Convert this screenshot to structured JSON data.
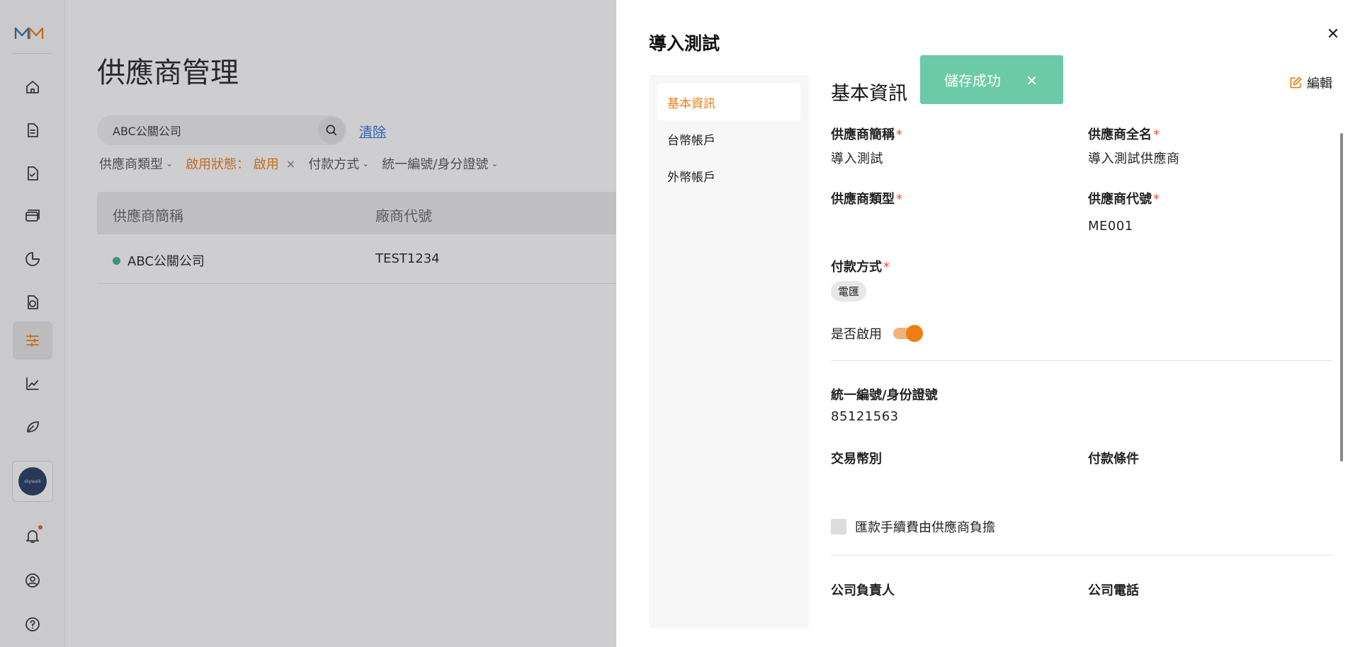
{
  "nav": {
    "logo_alt": "MM",
    "org_label": "skywalk",
    "items": [
      "home",
      "document",
      "invoice-check",
      "card",
      "pie-chart",
      "coin-document",
      "sliders",
      "line-chart",
      "leaf"
    ],
    "bottom": [
      "bell",
      "user-circle",
      "help-circle"
    ]
  },
  "page": {
    "title": "供應商管理",
    "search_value": "ABC公關公司",
    "clear_label": "清除",
    "filters": {
      "type": "供應商類型",
      "status": "啟用狀態： 啟用",
      "payment": "付款方式",
      "tax_id": "統一編號/身分證號"
    },
    "table": {
      "headers": [
        "供應商簡稱",
        "廠商代號"
      ],
      "rows": [
        {
          "name": "ABC公關公司",
          "code": "TEST1234"
        }
      ]
    }
  },
  "drawer": {
    "title": "導入測試",
    "tabs": [
      "基本資訊",
      "台幣帳戶",
      "外幣帳戶"
    ],
    "section_title": "基本資訊",
    "edit_label": "編輯",
    "fields": {
      "short_name_label": "供應商簡稱",
      "short_name_value": "導入測試",
      "full_name_label": "供應商全名",
      "full_name_value": "導入測試供應商",
      "type_label": "供應商類型",
      "code_label": "供應商代號",
      "code_value": "ME001",
      "payment_label": "付款方式",
      "payment_value": "電匯",
      "enabled_label": "是否啟用",
      "tax_id_label": "統一編號/身份證號",
      "tax_id_value": "85121563",
      "currency_label": "交易幣別",
      "terms_label": "付款條件",
      "fee_label": "匯款手續費由供應商負擔",
      "principal_label": "公司負責人",
      "phone_label": "公司電話"
    },
    "enabled": true
  },
  "toast": {
    "message": "儲存成功"
  },
  "colors": {
    "accent": "#ef7d14",
    "toast": "#6dcaa9",
    "link": "#2d6fd0",
    "status_active": "#3bb089"
  }
}
